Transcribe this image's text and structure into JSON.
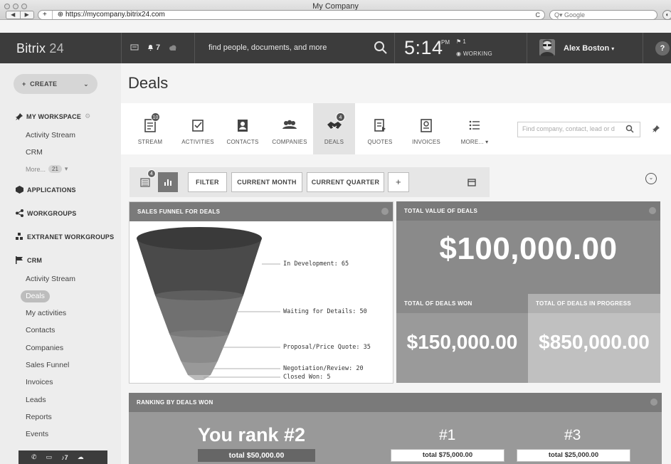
{
  "window": {
    "title": "My Company",
    "url": "https://mycompany.bitrix24.com",
    "search_placeholder": "Q▾ Google"
  },
  "header": {
    "logo_main": "Bitrix",
    "logo_num": " 24",
    "notifications_count": "7",
    "search_placeholder": "find people, documents, and more",
    "clock_time": "5:14",
    "clock_ampm": "PM",
    "clock_flag_count": "1",
    "working_status": "WORKING",
    "user_name": "Alex Boston",
    "help_label": "?"
  },
  "sidebar": {
    "create_label": "CREATE",
    "my_workspace": "MY WORKSPACE",
    "activity_stream": "Activity Stream",
    "crm_link": "CRM",
    "more_label": "More...",
    "more_count": "21",
    "applications": "APPLICATIONS",
    "workgroups": "WORKGROUPS",
    "extranet": "EXTRANET WORKGROUPS",
    "crm_section": "CRM",
    "crm_items": [
      "Activity Stream",
      "Deals",
      "My activities",
      "Contacts",
      "Companies",
      "Sales Funnel",
      "Invoices",
      "Leads",
      "Reports",
      "Events"
    ],
    "bottom_notif": "7"
  },
  "page": {
    "title": "Deals"
  },
  "tabs": [
    {
      "label": "STREAM",
      "badge": "10"
    },
    {
      "label": "ACTIVITIES",
      "badge": ""
    },
    {
      "label": "CONTACTS",
      "badge": ""
    },
    {
      "label": "COMPANIES",
      "badge": ""
    },
    {
      "label": "DEALS",
      "badge": "4"
    },
    {
      "label": "QUOTES",
      "badge": ""
    },
    {
      "label": "INVOICES",
      "badge": ""
    },
    {
      "label": "MORE... ▾",
      "badge": ""
    }
  ],
  "crm_search_placeholder": "Find company, contact, lead or d",
  "filters": {
    "view_badge": "4",
    "filter_label": "FILTER",
    "month_label": "CURRENT MONTH",
    "quarter_label": "CURRENT QUARTER",
    "add_label": "+"
  },
  "funnel": {
    "title": "SALES FUNNEL FOR DEALS",
    "stages": [
      {
        "label": "In Development: 65",
        "value": 65
      },
      {
        "label": "Waiting for Details: 50",
        "value": 50
      },
      {
        "label": "Proposal/Price Quote: 35",
        "value": 35
      },
      {
        "label": "Negotiation/Review: 20",
        "value": 20
      },
      {
        "label": "Closed Won: 5",
        "value": 5
      }
    ]
  },
  "totals": {
    "value_title": "TOTAL VALUE OF DEALS",
    "value_amount": "$100,000.00",
    "won_title": "TOTAL OF DEALS WON",
    "won_amount": "$150,000.00",
    "progress_title": "TOTAL OF DEALS IN PROGRESS",
    "progress_amount": "$850,000.00"
  },
  "ranking": {
    "title": "RANKING BY DEALS WON",
    "you_rank": "You rank #2",
    "you_total": "total $50,000.00",
    "first_rank": "#1",
    "first_total": "total $75,000.00",
    "third_rank": "#3",
    "third_total": "total $25,000.00"
  }
}
